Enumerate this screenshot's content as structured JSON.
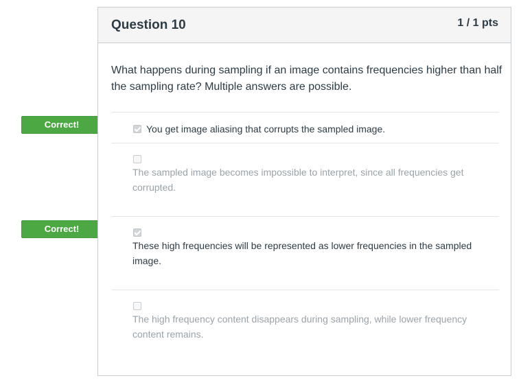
{
  "question": {
    "title": "Question 10",
    "points": "1 / 1 pts",
    "text": "What happens during sampling if an image contains frequencies higher than half the sampling rate? Multiple answers are possible."
  },
  "flags": {
    "correct_label": "Correct!",
    "color": "#4ca842"
  },
  "answers": [
    {
      "text": "You get image aliasing that corrupts the sampled image.",
      "checked": true,
      "correct": true
    },
    {
      "text": "The sampled image becomes impossible to interpret, since all frequencies get corrupted.",
      "checked": false,
      "correct": false
    },
    {
      "text": "These high frequencies will be represented as lower frequencies in the sampled image.",
      "checked": true,
      "correct": true
    },
    {
      "text": "The high frequency content disappears during sampling, while lower frequency content remains.",
      "checked": false,
      "correct": false
    }
  ]
}
